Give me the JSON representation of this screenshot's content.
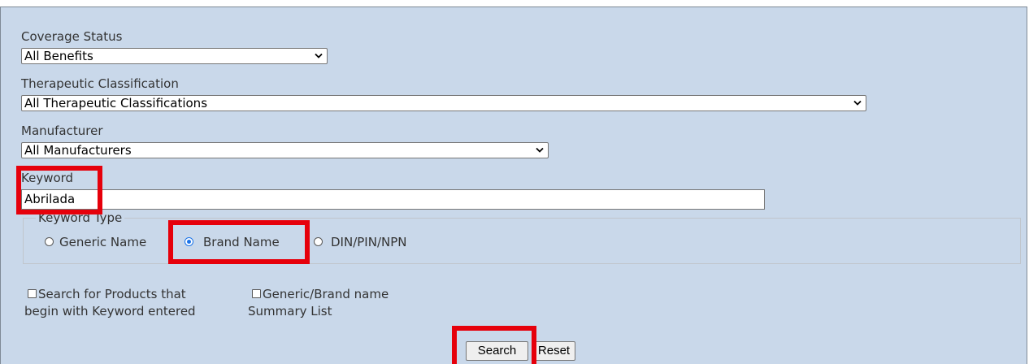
{
  "form": {
    "coverage_status": {
      "label": "Coverage Status",
      "value": "All Benefits"
    },
    "therapeutic_classification": {
      "label": "Therapeutic Classification",
      "value": "All Therapeutic Classifications"
    },
    "manufacturer": {
      "label": "Manufacturer",
      "value": "All Manufacturers"
    },
    "keyword": {
      "label": "Keyword",
      "value": "Abrilada"
    },
    "keyword_type": {
      "legend": "Keyword Type",
      "options": [
        "Generic Name",
        "Brand Name",
        "DIN/PIN/NPN"
      ],
      "selected": "Brand Name"
    },
    "options": {
      "begin_with_keyword": {
        "line1": "Search for Products that",
        "line2": "begin with Keyword entered",
        "checked": false
      },
      "summary_list": {
        "line1": "Generic/Brand name",
        "line2": "Summary List",
        "checked": false
      }
    },
    "buttons": {
      "search": "Search",
      "reset": "Reset"
    }
  },
  "highlight_color": "#e6000b",
  "panel_color": "#c9d8ea"
}
